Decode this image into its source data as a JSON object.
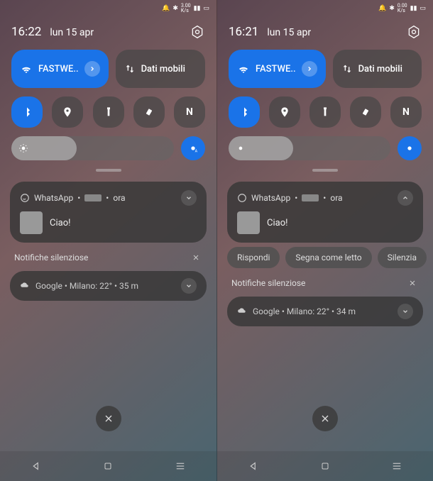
{
  "left": {
    "time": "16:22",
    "date": "lun 15 apr",
    "wifi_label": "FASTWE..",
    "data_label": "Dati mobili",
    "whatsapp": {
      "app": "WhatsApp",
      "time": "ora",
      "message": "Ciao!"
    },
    "silent_header": "Notifiche silenziose",
    "weather": "Google • Milano: 22° • 35 m"
  },
  "right": {
    "time": "16:21",
    "date": "lun 15 apr",
    "wifi_label": "FASTWE..",
    "data_label": "Dati mobili",
    "whatsapp": {
      "app": "WhatsApp",
      "time": "ora",
      "message": "Ciao!"
    },
    "actions": {
      "reply": "Rispondi",
      "mark_read": "Segna come letto",
      "mute": "Silenzia"
    },
    "silent_header": "Notifiche silenziose",
    "weather": "Google • Milano: 22° • 34 m"
  }
}
